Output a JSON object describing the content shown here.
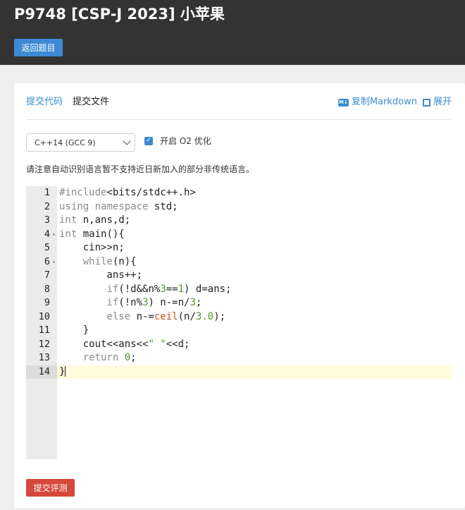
{
  "header": {
    "title": "P9748 [CSP-J 2023] 小苹果",
    "back_label": "返回题目",
    "background": "#333333"
  },
  "tabs": [
    {
      "label": "提交代码",
      "active": true
    },
    {
      "label": "提交文件",
      "active": false
    }
  ],
  "actions": {
    "copy_markdown": "复制Markdown",
    "copy_markdown_icon": "markdown-icon",
    "expand": "展开",
    "expand_icon": "expand-icon"
  },
  "language_select": {
    "selected": "C++14 (GCC 9)"
  },
  "o2": {
    "checked": true,
    "label": "开启 O2 优化"
  },
  "notice": "请注意自动识别语言暂不支持近日新加入的部分非传统语言。",
  "editor": {
    "active_line": 14,
    "lines": [
      {
        "n": "1",
        "text": "#include<bits/stdc++.h>"
      },
      {
        "n": "2",
        "text": "using namespace std;"
      },
      {
        "n": "3",
        "text": "int n,ans,d;"
      },
      {
        "n": "4",
        "text": "int main(){",
        "fold": true
      },
      {
        "n": "5",
        "text": "    cin>>n;"
      },
      {
        "n": "6",
        "text": "    while(n){",
        "fold": true
      },
      {
        "n": "7",
        "text": "        ans++;"
      },
      {
        "n": "8",
        "text": "        if(!d&&n%3==1) d=ans;"
      },
      {
        "n": "9",
        "text": "        if(!n%3) n-=n/3;"
      },
      {
        "n": "10",
        "text": "        else n-=ceil(n/3.0);"
      },
      {
        "n": "11",
        "text": "    }"
      },
      {
        "n": "12",
        "text": "    cout<<ans<<\" \"<<d;"
      },
      {
        "n": "13",
        "text": "    return 0;"
      },
      {
        "n": "14",
        "text": "}"
      }
    ]
  },
  "submit_label": "提交评测",
  "colors": {
    "accent_blue": "#3d8ad4",
    "submit_red": "#d5493b",
    "active_line": "#fffbdc"
  }
}
